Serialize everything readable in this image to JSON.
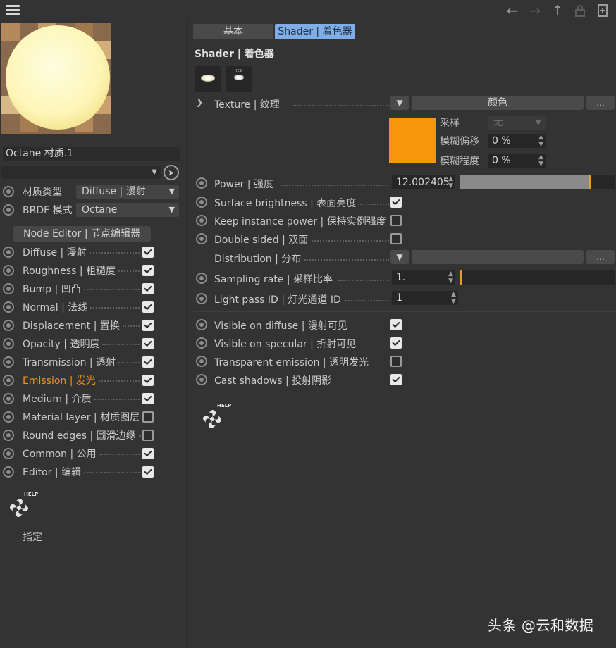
{
  "top_bar": {
    "icons": [
      "menu-icon",
      "back-arrow-icon",
      "forward-arrow-icon",
      "up-arrow-icon",
      "lock-icon",
      "new-window-icon"
    ]
  },
  "left_panel": {
    "material_name": "Octane 材质.1",
    "material_type": {
      "label": "材质类型",
      "value": "Diffuse | 漫射"
    },
    "brdf_mode": {
      "label": "BRDF 模式",
      "value": "Octane"
    },
    "node_editor_button": "Node Editor | 节点编辑器",
    "channels": [
      {
        "label": "Diffuse | 漫射",
        "checked": true,
        "active": false
      },
      {
        "label": "Roughness | 粗糙度",
        "checked": true,
        "active": false
      },
      {
        "label": "Bump | 凹凸",
        "checked": true,
        "active": false
      },
      {
        "label": "Normal | 法线",
        "checked": true,
        "active": false
      },
      {
        "label": "Displacement | 置换",
        "checked": true,
        "active": false
      },
      {
        "label": "Opacity | 透明度",
        "checked": true,
        "active": false
      },
      {
        "label": "Transmission | 透射",
        "checked": true,
        "active": false
      },
      {
        "label": "Emission | 发光",
        "checked": true,
        "active": true
      },
      {
        "label": "Medium | 介质",
        "checked": true,
        "active": false
      },
      {
        "label": "Material layer | 材质图层",
        "checked": false,
        "active": false
      },
      {
        "label": "Round edges | 圆滑边缘",
        "checked": false,
        "active": false
      },
      {
        "label": "Common | 公用",
        "checked": true,
        "active": false
      },
      {
        "label": "Editor | 编辑",
        "checked": true,
        "active": false
      }
    ],
    "help_label": "HELP",
    "assign_label": "指定"
  },
  "tabs": [
    {
      "label": "基本",
      "active": false
    },
    {
      "label": "Shader | 着色器",
      "active": true
    }
  ],
  "shader": {
    "section_title": "Shader | 着色器",
    "preview_ies_label": "IES",
    "texture": {
      "label": "Texture | 纹理",
      "button": "颜色",
      "more": "..."
    },
    "color_swatch": "#f7960b",
    "sampling": {
      "label": "采样",
      "value": "无"
    },
    "blur_offset": {
      "label": "模糊偏移",
      "value": "0 %"
    },
    "blur_scale": {
      "label": "模糊程度",
      "value": "0 %"
    },
    "power": {
      "label": "Power | 强度",
      "value": "12.002405",
      "slider_fraction": 0.85
    },
    "surface_brightness": {
      "label": "Surface brightness | 表面亮度",
      "checked": true
    },
    "keep_instance_power": {
      "label": "Keep instance power | 保持实例强度",
      "checked": false
    },
    "double_sided": {
      "label": "Double sided | 双面",
      "checked": false
    },
    "distribution": {
      "label": "Distribution | 分布",
      "more": "..."
    },
    "sampling_rate": {
      "label": "Sampling rate | 采样比率",
      "value": "1.",
      "slider_fraction": 0.0
    },
    "light_pass_id": {
      "label": "Light pass ID | 灯光通道 ID",
      "value": "1"
    },
    "visibility": [
      {
        "label": "Visible on diffuse | 漫射可见",
        "checked": true
      },
      {
        "label": "Visible on specular | 折射可见",
        "checked": true
      },
      {
        "label": "Transparent emission | 透明发光",
        "checked": false
      },
      {
        "label": "Cast shadows | 投射阴影",
        "checked": true
      }
    ],
    "help_label": "HELP"
  },
  "watermark": "头条 @云和数据",
  "colors": {
    "accent_orange": "#e69323",
    "tab_active": "#7eaee5",
    "slider_knob": "#e6a21a"
  }
}
